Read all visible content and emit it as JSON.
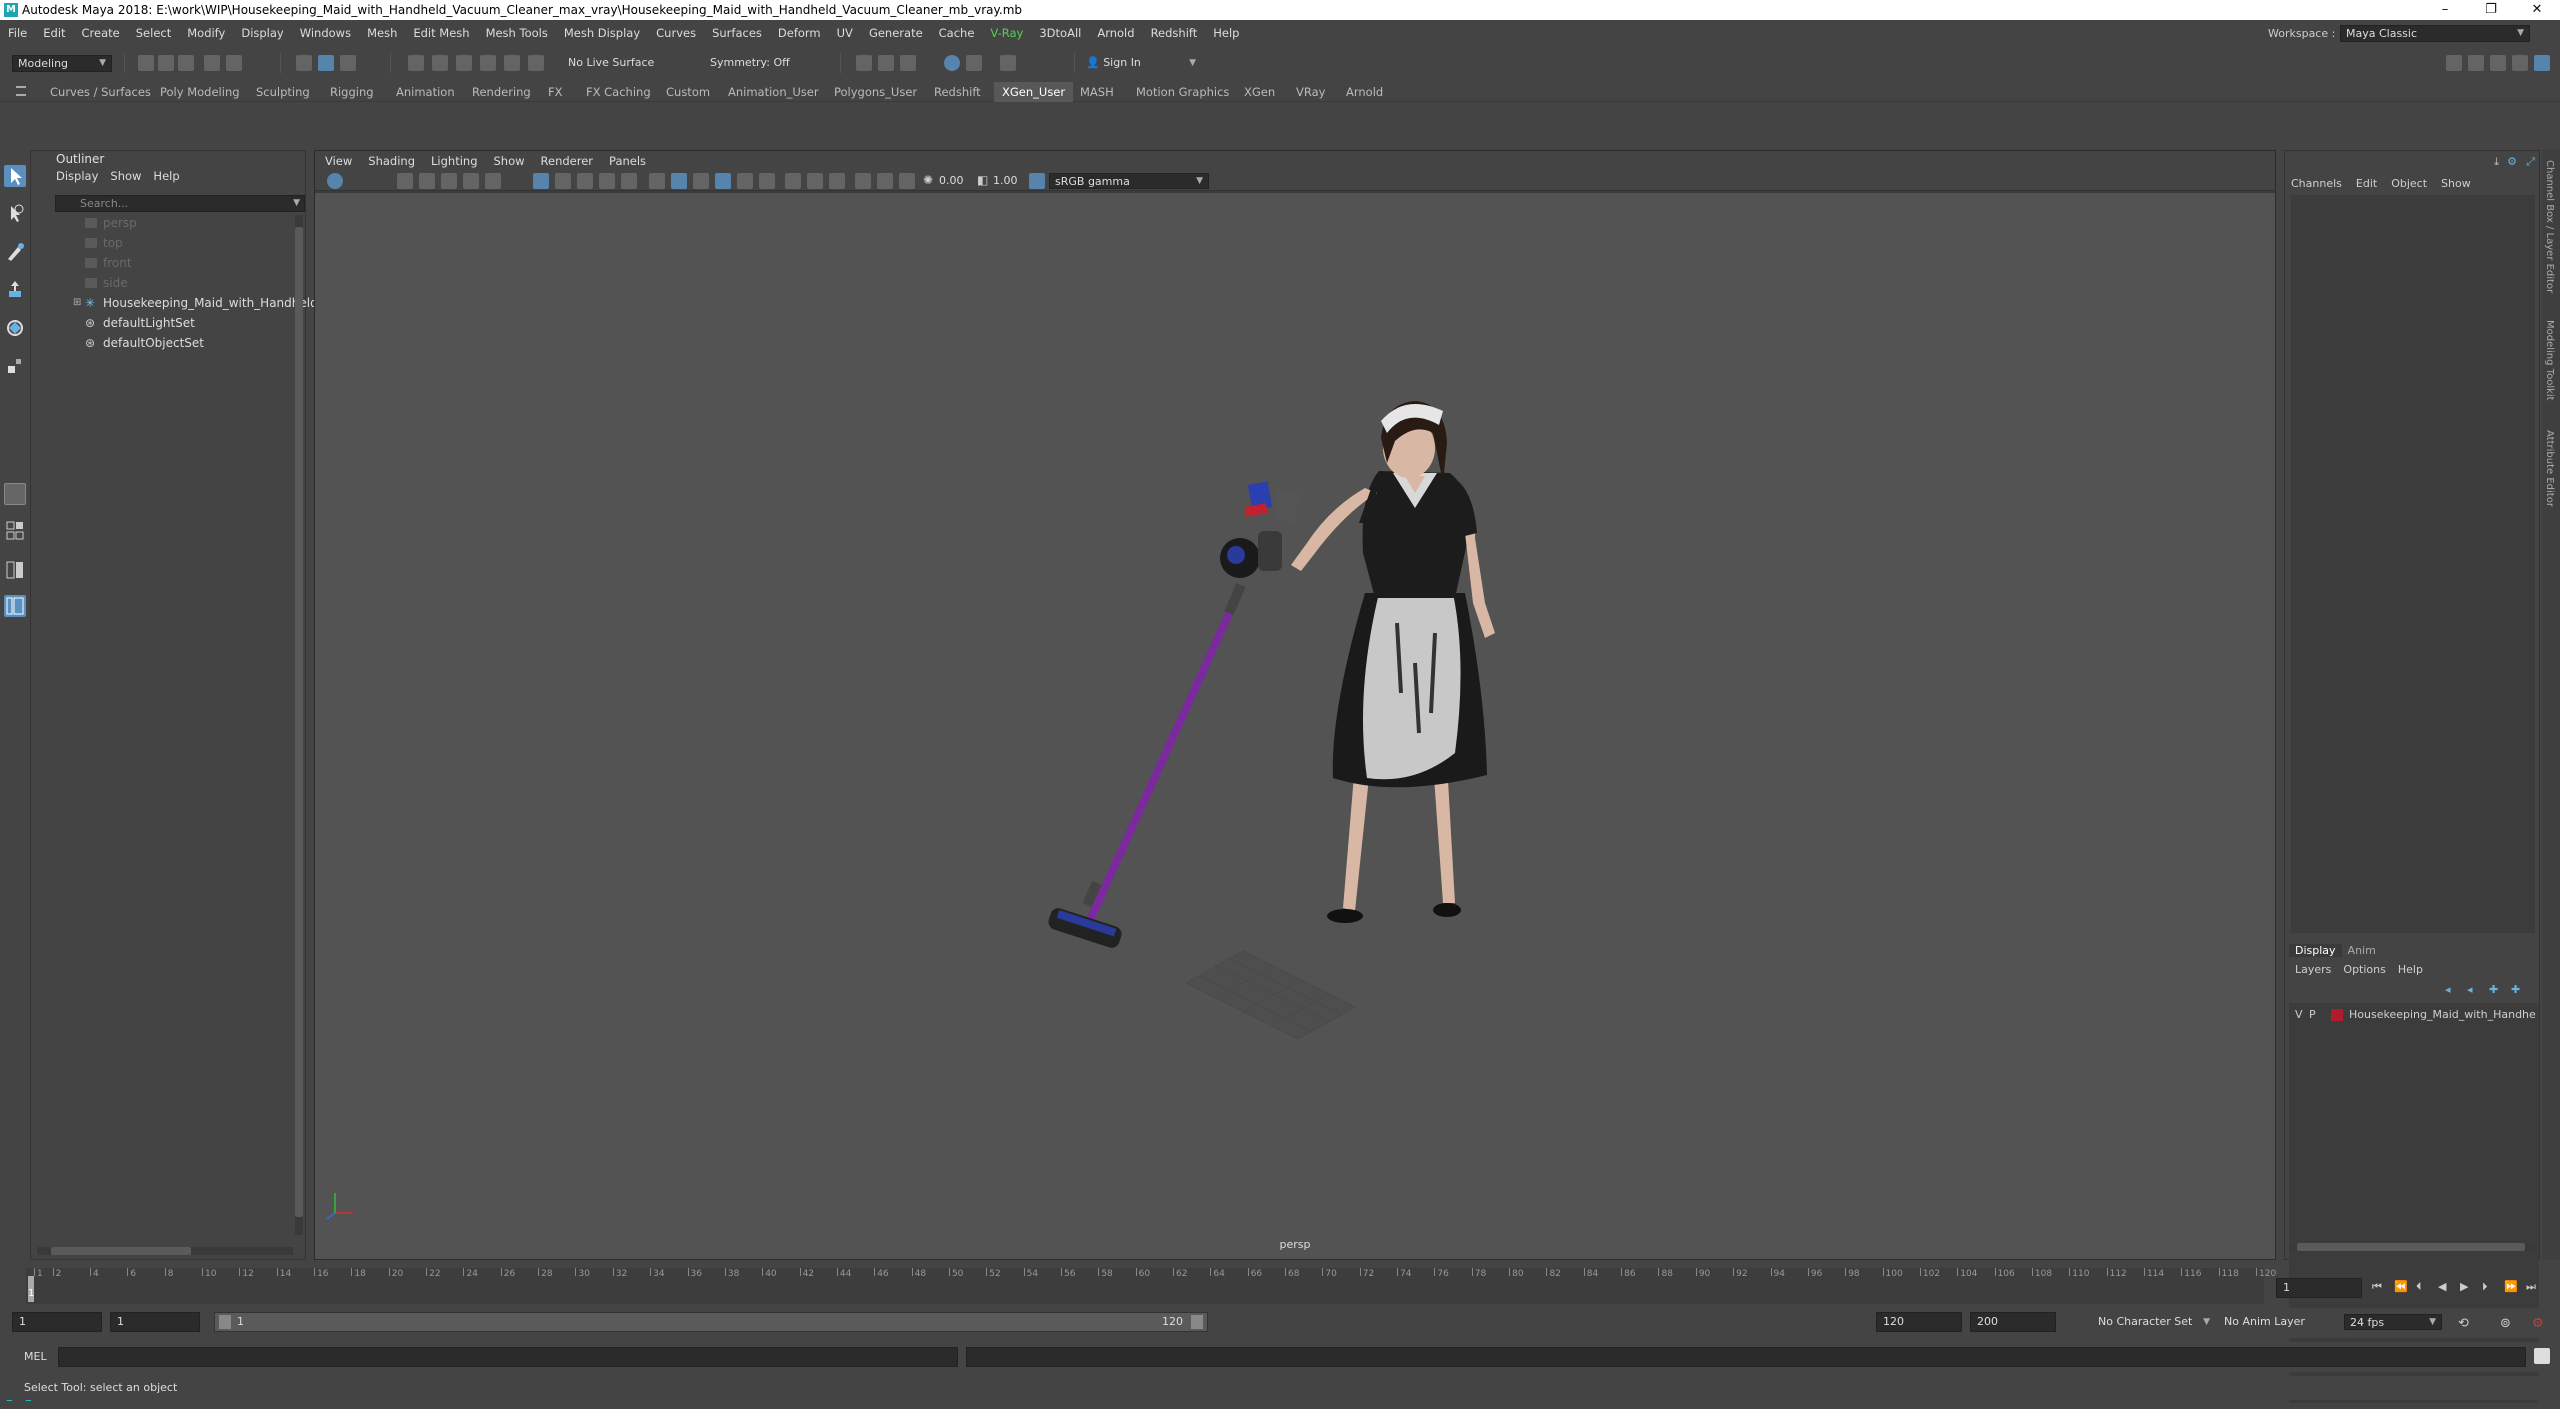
{
  "window": {
    "title": "Autodesk Maya 2018: E:\\work\\WIP\\Housekeeping_Maid_with_Handheld_Vacuum_Cleaner_max_vray\\Housekeeping_Maid_with_Handheld_Vacuum_Cleaner_mb_vray.mb",
    "minimize": "–",
    "restore": "❐",
    "close": "✕"
  },
  "menubar": [
    "File",
    "Edit",
    "Create",
    "Select",
    "Modify",
    "Display",
    "Windows",
    "Mesh",
    "Edit Mesh",
    "Mesh Tools",
    "Mesh Display",
    "Curves",
    "Surfaces",
    "Deform",
    "UV",
    "Generate",
    "Cache",
    "V-Ray",
    "3DtoAll",
    "Arnold",
    "Redshift",
    "Help"
  ],
  "workspace": {
    "label": "Workspace :",
    "value": "Maya Classic"
  },
  "statusline": {
    "mode": "Modeling",
    "live_surface": "No Live Surface",
    "symmetry": "Symmetry: Off",
    "sign_in": "Sign In"
  },
  "shelf_tabs": [
    "Curves / Surfaces",
    "Poly Modeling",
    "Sculpting",
    "Rigging",
    "Animation",
    "Rendering",
    "FX",
    "FX Caching",
    "Custom",
    "Animation_User",
    "Polygons_User",
    "Redshift",
    "XGen_User",
    "MASH",
    "Motion Graphics",
    "XGen",
    "VRay",
    "Arnold"
  ],
  "shelf_active": "XGen_User",
  "outliner": {
    "title": "Outliner",
    "menus": [
      "Display",
      "Show",
      "Help"
    ],
    "search_placeholder": "Search...",
    "items": [
      {
        "label": "persp",
        "dim": true
      },
      {
        "label": "top",
        "dim": true
      },
      {
        "label": "front",
        "dim": true
      },
      {
        "label": "side",
        "dim": true
      },
      {
        "label": "Housekeeping_Maid_with_Handheld",
        "dim": false
      },
      {
        "label": "defaultLightSet",
        "dim": false
      },
      {
        "label": "defaultObjectSet",
        "dim": false
      }
    ]
  },
  "viewport": {
    "menus": [
      "View",
      "Shading",
      "Lighting",
      "Show",
      "Renderer",
      "Panels"
    ],
    "exposure": "0.00",
    "gamma": "1.00",
    "colorspace": "sRGB gamma",
    "camera": "persp"
  },
  "channelbox": {
    "menus": [
      "Channels",
      "Edit",
      "Object",
      "Show"
    ],
    "side_tabs": [
      "Channel Box / Layer Editor",
      "Modeling Toolkit",
      "Attribute Editor"
    ]
  },
  "layer_editor": {
    "tabs": [
      "Display",
      "Anim"
    ],
    "menus": [
      "Layers",
      "Options",
      "Help"
    ],
    "layer": {
      "v": "V",
      "p": "P",
      "name": "Housekeeping_Maid_with_Handhe",
      "color": "#b01c2e"
    }
  },
  "timeline": {
    "ticks": [
      "1",
      "2",
      "4",
      "6",
      "8",
      "10",
      "12",
      "14",
      "16",
      "18",
      "20",
      "22",
      "24",
      "26",
      "28",
      "30",
      "32",
      "34",
      "36",
      "38",
      "40",
      "42",
      "44",
      "46",
      "48",
      "50",
      "52",
      "54",
      "56",
      "58",
      "60",
      "62",
      "64",
      "66",
      "68",
      "70",
      "72",
      "74",
      "76",
      "78",
      "80",
      "82",
      "84",
      "86",
      "88",
      "90",
      "92",
      "94",
      "96",
      "98",
      "100",
      "102",
      "104",
      "106",
      "108",
      "110",
      "112",
      "114",
      "116",
      "118",
      "120"
    ],
    "current_frame": "1"
  },
  "range": {
    "start": "1",
    "inner_start": "1",
    "slider_start": "1",
    "slider_end": "120",
    "end": "120",
    "outer_end": "200",
    "character_set": "No Character Set",
    "anim_layer": "No Anim Layer",
    "fps": "24 fps"
  },
  "cmdline": {
    "label": "MEL"
  },
  "helpline": "Select Tool: select an object"
}
